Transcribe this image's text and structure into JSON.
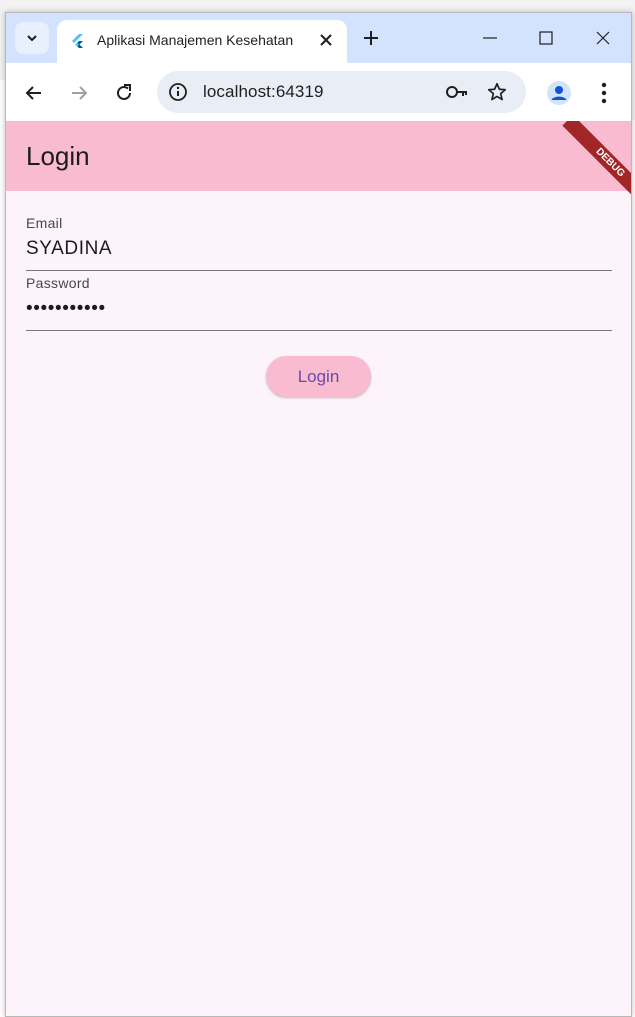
{
  "browser": {
    "tab_title": "Aplikasi Manajemen Kesehatan",
    "url": "localhost:64319"
  },
  "app": {
    "appbar_title": "Login",
    "debug_banner": "DEBUG",
    "email": {
      "label": "Email",
      "value": "SYADINA"
    },
    "password": {
      "label": "Password",
      "value": "•••••••••••"
    },
    "login_button": "Login"
  },
  "colors": {
    "appbar": "#f8bbd0",
    "background": "#fdf4fb",
    "button_text": "#6a4aa8",
    "tabbar": "#d3e3fd"
  }
}
